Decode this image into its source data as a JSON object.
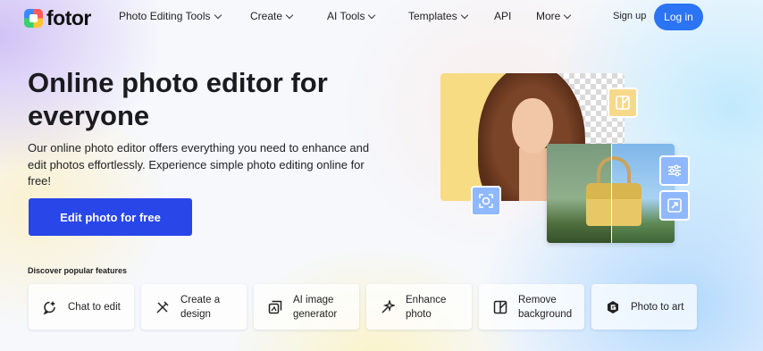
{
  "brand": {
    "name": "fotor"
  },
  "nav": {
    "items": [
      {
        "label": "Photo Editing Tools",
        "dropdown": true
      },
      {
        "label": "Create",
        "dropdown": true
      },
      {
        "label": "AI Tools",
        "dropdown": true
      },
      {
        "label": "Templates",
        "dropdown": true
      },
      {
        "label": "API",
        "dropdown": false
      },
      {
        "label": "More",
        "dropdown": true
      }
    ],
    "signup_label": "Sign up",
    "login_label": "Log in"
  },
  "hero": {
    "title": "Online photo editor for everyone",
    "description": "Our online photo editor offers everything you need to enhance and edit photos effortlessly. Experience simple photo editing online for free!",
    "cta_label": "Edit photo for free"
  },
  "features": {
    "heading": "Discover popular features",
    "items": [
      {
        "label": "Chat to edit",
        "icon": "chat-edit-icon"
      },
      {
        "label": "Create a design",
        "icon": "design-pen-icon"
      },
      {
        "label": "AI image generator",
        "icon": "ai-image-icon"
      },
      {
        "label": "Enhance photo",
        "icon": "sparkle-enhance-icon"
      },
      {
        "label": "Remove background",
        "icon": "remove-bg-icon"
      },
      {
        "label": "Photo to art",
        "icon": "art-hexagon-icon"
      }
    ]
  },
  "colors": {
    "accent": "#2b74f4",
    "cta": "#2946e8"
  }
}
